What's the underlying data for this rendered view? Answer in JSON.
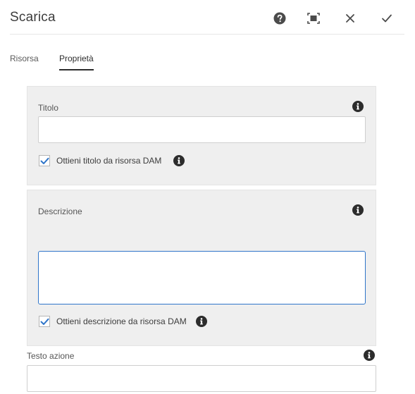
{
  "dialog": {
    "title": "Scarica",
    "buttons": {
      "help": "help-icon",
      "fullscreen": "fullscreen-icon",
      "cancel": "close-icon",
      "confirm": "checkmark-icon"
    }
  },
  "tabs": [
    {
      "label": "Risorsa",
      "active": false
    },
    {
      "label": "Proprietà",
      "active": true
    }
  ],
  "fields": {
    "titolo": {
      "label": "Titolo",
      "value": "",
      "checkbox_label": "Ottieni titolo da risorsa DAM",
      "checkbox_checked": true
    },
    "descrizione": {
      "label": "Descrizione",
      "value": "",
      "checkbox_label": "Ottieni descrizione da risorsa DAM",
      "checkbox_checked": true
    },
    "testo_azione": {
      "label": "Testo azione",
      "value": ""
    }
  },
  "colors": {
    "accent": "#2f75c9",
    "panel_bg": "#efefef",
    "text": "#3c3c3c"
  }
}
